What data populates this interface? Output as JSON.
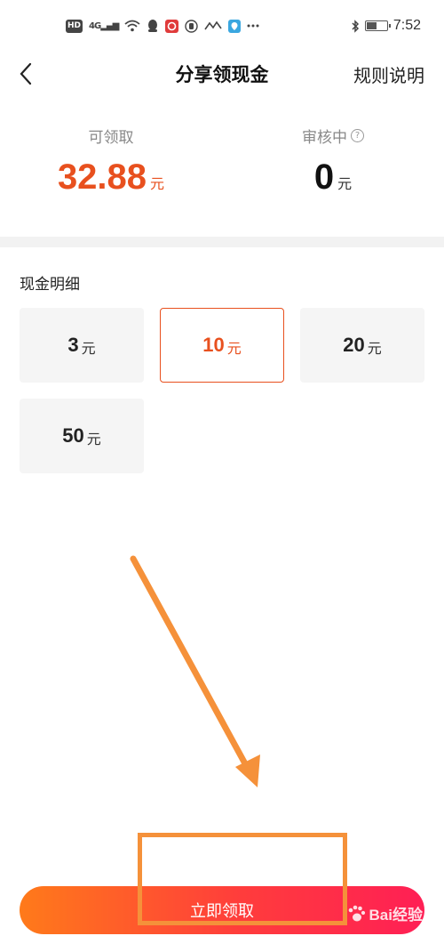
{
  "status_bar": {
    "hd_label": "HD",
    "signal_label": "4G",
    "time": "7:52"
  },
  "header": {
    "title": "分享领现金",
    "rules_label": "规则说明"
  },
  "balance": {
    "available_label": "可领取",
    "available_value": "32.88",
    "available_unit": "元",
    "review_label": "审核中",
    "review_value": "0",
    "review_unit": "元"
  },
  "section": {
    "title": "现金明细"
  },
  "amounts": [
    {
      "value": "3",
      "unit": "元",
      "selected": false
    },
    {
      "value": "10",
      "unit": "元",
      "selected": true
    },
    {
      "value": "20",
      "unit": "元",
      "selected": false
    },
    {
      "value": "50",
      "unit": "元",
      "selected": false
    }
  ],
  "claim_button": {
    "label": "立即领取"
  },
  "watermark": {
    "text": "Bai经验"
  },
  "colors": {
    "accent": "#e8501e",
    "annotation": "#f5913a"
  }
}
